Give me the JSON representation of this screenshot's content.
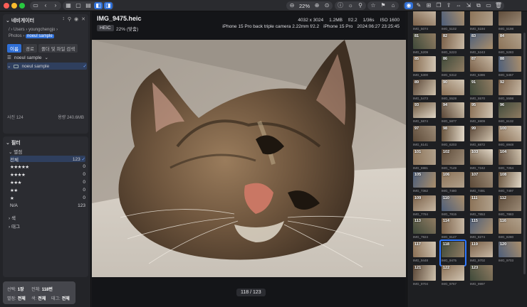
{
  "toolbar": {
    "zoom_label": "22%"
  },
  "sidebar": {
    "nav_title": "네비게이터",
    "breadcrumb": [
      "/",
      "Users",
      "youngchengjo",
      "Photos",
      "noeul sample"
    ],
    "tabs": [
      "이름",
      "경로",
      "폴더 및 파일 검색"
    ],
    "tree": [
      {
        "label": "noeul sample",
        "selected": false
      },
      {
        "label": "noeul sample",
        "selected": true
      }
    ],
    "photo_count": "사진 124",
    "capacity": "용량 240.6MB",
    "filter_title": "필터",
    "rating_section": "별점",
    "ratings": [
      {
        "label": "전체",
        "count": "123"
      },
      {
        "label": "★★★★★",
        "count": "0"
      },
      {
        "label": "★★★★",
        "count": "0"
      },
      {
        "label": "★★★",
        "count": "0"
      },
      {
        "label": "★★",
        "count": "0"
      },
      {
        "label": "★",
        "count": "0"
      },
      {
        "label": "N/A",
        "count": "123"
      }
    ],
    "color_section": "색",
    "tag_section": "태그"
  },
  "status": {
    "select_label": "선택:",
    "select_val": "1장",
    "total_label": "전체:",
    "total_val": "118번",
    "rating_label": "별점:",
    "rating_val": "전체",
    "color_label": "색:",
    "color_val": "전체",
    "tag_label": "태그:",
    "tag_val": "전체"
  },
  "viewer": {
    "file_name": "IMG_9475.heic",
    "format_badge": "HEIC",
    "zoom_mode": "22% (맞춤)",
    "dimensions": "4032 x 3024",
    "size": "1.2MB",
    "aperture": "f/2.2",
    "shutter": "1/36s",
    "iso": "ISO 1600",
    "lens": "iPhone 15 Pro back triple camera 2.22mm f/2.2",
    "camera": "iPhone 15 Pro",
    "datetime": "2024:06:27 23:25:45",
    "counter": "118 / 123"
  },
  "filmstrip": [
    {
      "num": "",
      "name": "IMG_5074"
    },
    {
      "num": "",
      "name": "IMG_5102"
    },
    {
      "num": "",
      "name": "IMG_5194"
    },
    {
      "num": "",
      "name": "IMG_5198"
    },
    {
      "num": "81",
      "name": "IMG_5209"
    },
    {
      "num": "82",
      "name": "IMG_5223"
    },
    {
      "num": "83",
      "name": "IMG_5243"
    },
    {
      "num": "84",
      "name": "IMG_5283"
    },
    {
      "num": "85",
      "name": "IMG_5300"
    },
    {
      "num": "86",
      "name": "IMG_5312"
    },
    {
      "num": "87",
      "name": "IMG_5386"
    },
    {
      "num": "88",
      "name": "IMG_5457"
    },
    {
      "num": "89",
      "name": "IMG_5473"
    },
    {
      "num": "90",
      "name": "IMG_5528"
    },
    {
      "num": "91",
      "name": "IMG_5570"
    },
    {
      "num": "92",
      "name": "IMG_5598"
    },
    {
      "num": "93",
      "name": "IMG_5874"
    },
    {
      "num": "94",
      "name": "IMG_5877"
    },
    {
      "num": "95",
      "name": "IMG_6909"
    },
    {
      "num": "96",
      "name": "IMG_6132"
    },
    {
      "num": "97",
      "name": "IMG_6141"
    },
    {
      "num": "98",
      "name": "IMG_6203"
    },
    {
      "num": "99",
      "name": "IMG_6872"
    },
    {
      "num": "100",
      "name": "IMG_6948"
    },
    {
      "num": "101",
      "name": "IMG_6981"
    },
    {
      "num": "102",
      "name": "IMG_7149"
    },
    {
      "num": "103",
      "name": "IMG_7242"
    },
    {
      "num": "104",
      "name": "IMG_7254"
    },
    {
      "num": "105",
      "name": "IMG_7362"
    },
    {
      "num": "106",
      "name": "IMG_7480"
    },
    {
      "num": "107",
      "name": "IMG_7491"
    },
    {
      "num": "108",
      "name": "IMG_7497"
    },
    {
      "num": "109",
      "name": "IMG_7784"
    },
    {
      "num": "110",
      "name": "IMG_7815"
    },
    {
      "num": "111",
      "name": "IMG_7853"
    },
    {
      "num": "112",
      "name": "IMG_7883"
    },
    {
      "num": "113",
      "name": "IMG_7924"
    },
    {
      "num": "114",
      "name": "IMG_8147"
    },
    {
      "num": "115",
      "name": "IMG_8274"
    },
    {
      "num": "116",
      "name": "IMG_8280"
    },
    {
      "num": "117",
      "name": "IMG_9448"
    },
    {
      "num": "118",
      "name": "IMG_9475"
    },
    {
      "num": "119",
      "name": "IMG_9702"
    },
    {
      "num": "120",
      "name": "IMG_9703"
    },
    {
      "num": "121",
      "name": "IMG_9704"
    },
    {
      "num": "122",
      "name": "IMG_9767"
    },
    {
      "num": "123",
      "name": "IMG_9997"
    }
  ],
  "selected_index": 41
}
